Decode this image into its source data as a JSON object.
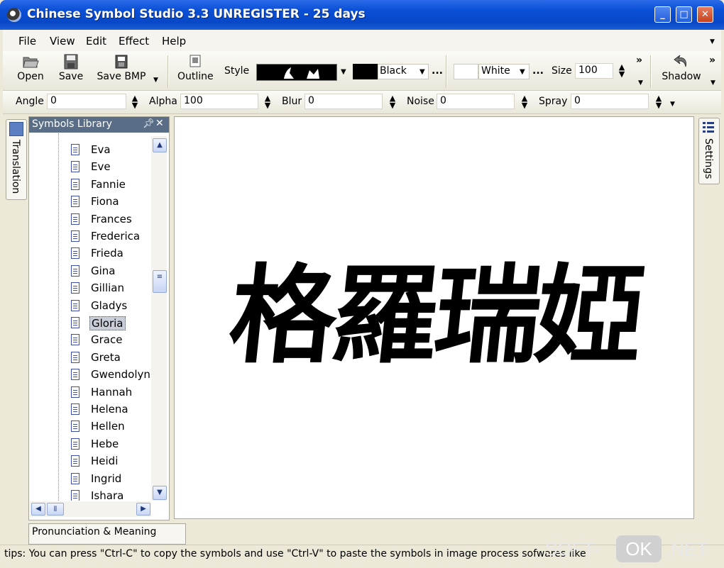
{
  "window": {
    "title": "Chinese Symbol Studio 3.3 UNREGISTER - 25 days"
  },
  "menu": [
    "File",
    "View",
    "Edit",
    "Effect",
    "Help"
  ],
  "toolbar": {
    "open": "Open",
    "save": "Save",
    "save_bmp": "Save BMP",
    "outline": "Outline",
    "style_label": "Style",
    "color1": "Black",
    "color2": "White",
    "size_label": "Size",
    "size_value": "100",
    "shadow": "Shadow",
    "more": "»"
  },
  "effects": {
    "angle_label": "Angle",
    "angle_value": "0",
    "alpha_label": "Alpha",
    "alpha_value": "100",
    "blur_label": "Blur",
    "blur_value": "0",
    "noise_label": "Noise",
    "noise_value": "0",
    "spray_label": "Spray",
    "spray_value": "0"
  },
  "side": {
    "translation": "Translation",
    "settings": "Settings"
  },
  "library": {
    "title": "Symbols Library",
    "items": [
      "Eva",
      "Eve",
      "Fannie",
      "Fiona",
      "Frances",
      "Frederica",
      "Frieda",
      "Gina",
      "Gillian",
      "Gladys",
      "Gloria",
      "Grace",
      "Greta",
      "Gwendolyn",
      "Hannah",
      "Helena",
      "Hellen",
      "Hebe",
      "Heidi",
      "Ingrid",
      "Ishara"
    ],
    "selected": "Gloria"
  },
  "canvas": {
    "symbols": "格羅瑞婭"
  },
  "bottom": {
    "pronunciation_tab": "Pronunciation & Meaning"
  },
  "status": {
    "tip": "tips: You can press \"Ctrl-C\" to copy the symbols and use \"Ctrl-V\" to paste the symbols in image process sofwares like"
  },
  "watermark": {
    "left": "SOFT-",
    "mid": "OK",
    "right": ".NET"
  }
}
